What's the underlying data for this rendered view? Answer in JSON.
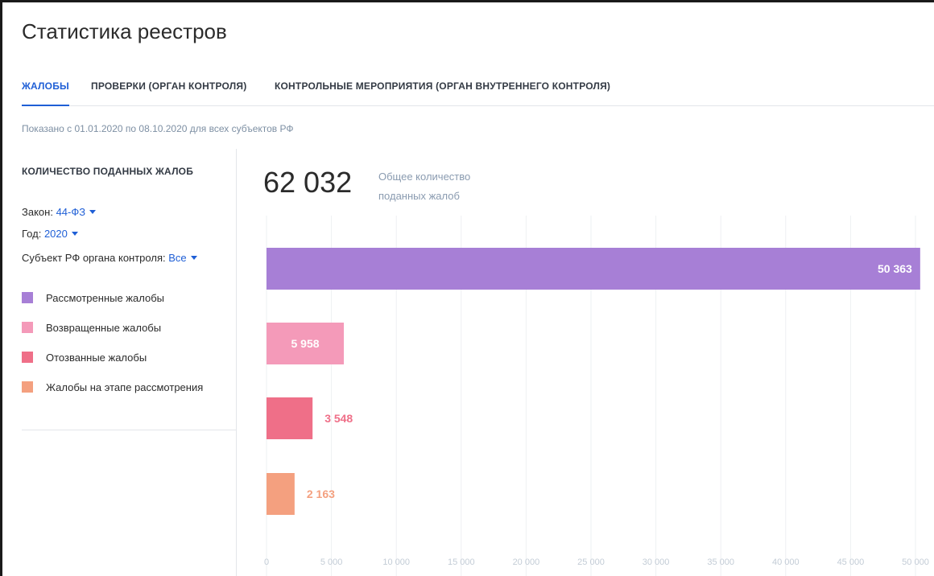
{
  "page": {
    "title": "Статистика реестров"
  },
  "tabs": [
    {
      "label": "ЖАЛОБЫ",
      "active": true
    },
    {
      "label": "ПРОВЕРКИ (ОРГАН КОНТРОЛЯ)",
      "active": false
    },
    {
      "label": "КОНТРОЛЬНЫЕ МЕРОПРИЯТИЯ (ОРГАН ВНУТРЕННЕГО КОНТРОЛЯ)",
      "active": false
    }
  ],
  "period_text": "Показано с 01.01.2020 по 08.10.2020 для всех субъектов РФ",
  "left_panel": {
    "title": "КОЛИЧЕСТВО ПОДАННЫХ ЖАЛОБ",
    "filters": [
      {
        "label": "Закон:",
        "value": "44-ФЗ"
      },
      {
        "label": "Год:",
        "value": "2020"
      },
      {
        "label": "Субъект РФ органа контроля:",
        "value": "Все"
      }
    ]
  },
  "summary": {
    "total": "62 032",
    "caption_line1": "Общее количество",
    "caption_line2": "поданных жалоб"
  },
  "colors": {
    "accent": "#1f5fd6",
    "considered": "#a77fd6",
    "returned": "#f49ab9",
    "withdrawn": "#ef6f88",
    "in_review": "#f4a07f"
  },
  "chart_data": {
    "type": "bar",
    "orientation": "horizontal",
    "xlim": [
      0,
      50000
    ],
    "x_ticks": [
      0,
      5000,
      10000,
      15000,
      20000,
      25000,
      30000,
      35000,
      40000,
      45000,
      50000
    ],
    "x_tick_labels": [
      "0",
      "5 000",
      "10 000",
      "15 000",
      "20 000",
      "25 000",
      "30 000",
      "35 000",
      "40 000",
      "45 000",
      "50 000"
    ],
    "grid": true,
    "series": [
      {
        "name": "Рассмотренные жалобы",
        "value": 50363,
        "label": "50 363",
        "color": "#a77fd6"
      },
      {
        "name": "Возвращенные жалобы",
        "value": 5958,
        "label": "5 958",
        "color": "#f49ab9"
      },
      {
        "name": "Отозванные жалобы",
        "value": 3548,
        "label": "3 548",
        "color": "#ef6f88"
      },
      {
        "name": "Жалобы на этапе рассмотрения",
        "value": 2163,
        "label": "2 163",
        "color": "#f4a07f"
      }
    ]
  }
}
